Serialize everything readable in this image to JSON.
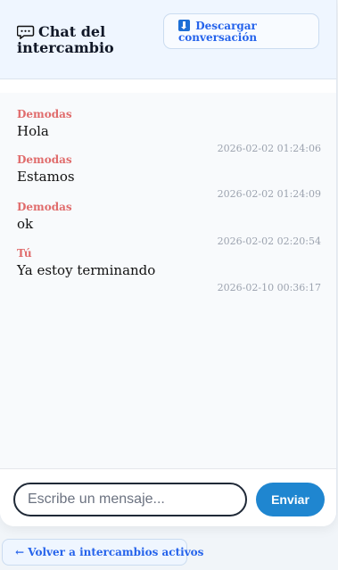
{
  "header": {
    "title": "Chat del intercambio",
    "title_icon": "chat-bubble-icon",
    "download_label": "Descargar conversación",
    "download_icon": "download-icon"
  },
  "messages": [
    {
      "author": "Demodas",
      "text": "Hola",
      "time": "2026-02-02 01:24:06"
    },
    {
      "author": "Demodas",
      "text": "Estamos",
      "time": "2026-02-02 01:24:09"
    },
    {
      "author": "Demodas",
      "text": "ok",
      "time": "2026-02-02 02:20:54"
    },
    {
      "author": "Tú",
      "text": "Ya estoy terminando",
      "time": "2026-02-10 00:36:17"
    }
  ],
  "composer": {
    "placeholder": "Escribe un mensaje...",
    "value": "",
    "send_label": "Enviar"
  },
  "footer": {
    "back_label": "← Volver a intercambios activos"
  },
  "colors": {
    "accent": "#1f86d0",
    "link": "#2563eb",
    "author": "#e06c6c",
    "header_bg": "#eff6ff"
  }
}
